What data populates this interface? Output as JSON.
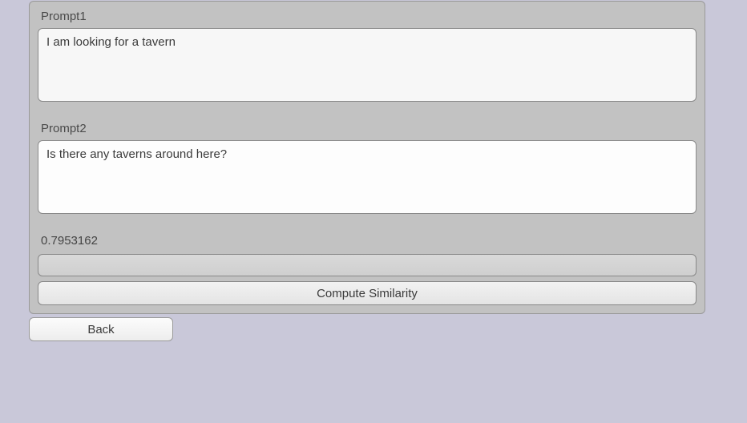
{
  "prompt1": {
    "label": "Prompt1",
    "value": "I am looking for a tavern"
  },
  "prompt2": {
    "label": "Prompt2",
    "value": "Is there any taverns around here?"
  },
  "result": {
    "score": "0.7953162"
  },
  "buttons": {
    "compute": "Compute Similarity",
    "back": "Back"
  }
}
